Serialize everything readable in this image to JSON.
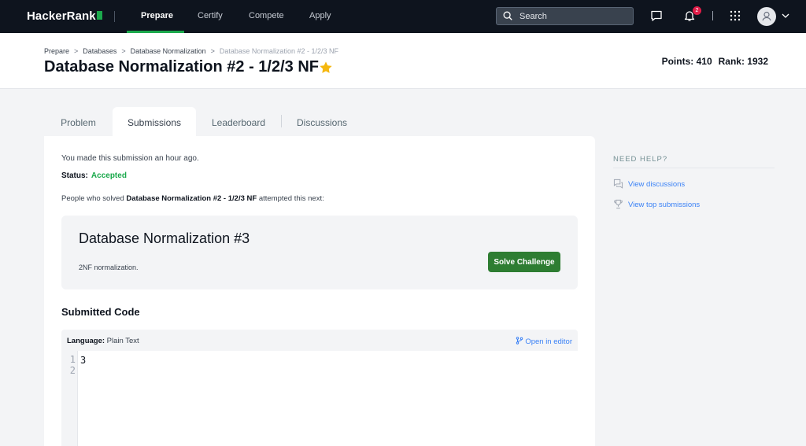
{
  "nav": {
    "logo": "HackerRank",
    "links": [
      "Prepare",
      "Certify",
      "Compete",
      "Apply"
    ],
    "search_placeholder": "Search",
    "notification_count": "2"
  },
  "header": {
    "breadcrumbs": [
      "Prepare",
      "Databases",
      "Database Normalization",
      "Database Normalization #2 - 1/2/3 NF"
    ],
    "title": "Database Normalization #2 - 1/2/3 NF",
    "points": "Points: 410",
    "rank": "Rank: 1932"
  },
  "tabs": [
    "Problem",
    "Submissions",
    "Leaderboard",
    "Discussions"
  ],
  "submission": {
    "message": "You made this submission an hour ago.",
    "status_label": "Status:",
    "status_value": "Accepted",
    "people_prefix": "People who solved",
    "people_challenge": "Database Normalization #2 - 1/2/3 NF",
    "people_suffix": "attempted this next:"
  },
  "next_challenge": {
    "title": "Database Normalization #3",
    "description": "2NF normalization.",
    "button": "Solve Challenge"
  },
  "code": {
    "heading": "Submitted Code",
    "language_label": "Language:",
    "language_value": "Plain Text",
    "open_editor": "Open in editor",
    "line_numbers": [
      "1",
      "2"
    ],
    "lines": [
      "3",
      ""
    ]
  },
  "help": {
    "heading": "NEED HELP?",
    "links": [
      "View discussions",
      "View top submissions"
    ]
  },
  "colors": {
    "nav_bg": "#0e141e",
    "accent_green": "#1ba94c",
    "button_green": "#2e7d32",
    "link_blue": "#3b82f6",
    "star": "#f5b70f"
  }
}
